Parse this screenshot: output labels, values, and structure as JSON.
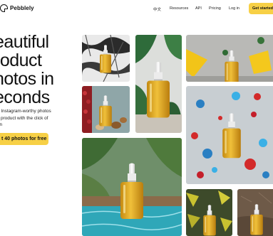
{
  "brand": {
    "name": "Pebblely"
  },
  "nav": {
    "links": [
      "中文",
      "Resources",
      "API",
      "Pricing",
      "Log in"
    ],
    "cta": "Get started"
  },
  "hero": {
    "headline_lines": [
      "eautiful",
      "roduct",
      "hotos in",
      "econds"
    ],
    "subtitle_lines": [
      "e Instagram-worthy photos",
      "y product with the click of",
      "on"
    ],
    "cta": "t 40 photos for free"
  },
  "gallery": {
    "photos": [
      "bottle-on-black-white-marble",
      "bottle-with-tropical-leaves",
      "bottle-with-yellow-flowers",
      "bottle-with-red-berries-and-nuts",
      "bottle-with-red-blue-splash",
      "bottle-by-pool-with-plants",
      "bottle-with-yellow-leaves",
      "bottle-on-brown-stone"
    ]
  },
  "colors": {
    "accent": "#f7d046",
    "oil": "#d9a21c"
  }
}
